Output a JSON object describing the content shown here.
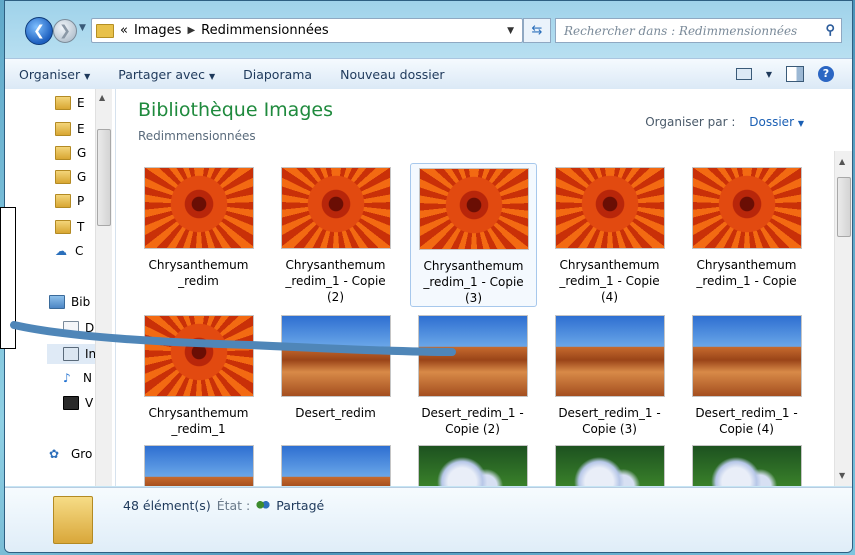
{
  "address": {
    "recent": "«",
    "crumbs": [
      "Images",
      "Redimmensionnées"
    ],
    "search_placeholder": "Rechercher dans : Redimmensionnées"
  },
  "toolbar": {
    "organize": "Organiser",
    "share": "Partager avec",
    "slideshow": "Diaporama",
    "new_folder": "Nouveau dossier"
  },
  "nav": {
    "items": [
      {
        "label": "E",
        "icon": "folder-icon"
      },
      {
        "label": "E",
        "icon": "folder-icon"
      },
      {
        "label": "G",
        "icon": "folder-icon"
      },
      {
        "label": "G",
        "icon": "folder-icon"
      },
      {
        "label": "P",
        "icon": "folder-icon"
      },
      {
        "label": "T",
        "icon": "download-folder-icon"
      },
      {
        "label": "C",
        "icon": "cloud-icon"
      },
      {
        "label": "Bib",
        "icon": "library-icon"
      },
      {
        "label": "D",
        "icon": "documents-icon"
      },
      {
        "label": "In",
        "icon": "images-icon"
      },
      {
        "label": "N",
        "icon": "music-icon"
      },
      {
        "label": "V",
        "icon": "video-icon"
      },
      {
        "label": "Gro",
        "icon": "homegroup-icon"
      }
    ]
  },
  "library": {
    "title": "Bibliothèque Images",
    "subtitle": "Redimmensionnées",
    "arrange_label": "Organiser par :",
    "arrange_value": "Dossier"
  },
  "files": [
    {
      "name": "Chrysanthemum _redim",
      "kind": "flower"
    },
    {
      "name": "Chrysanthemum _redim_1 - Copie (2)",
      "kind": "flower"
    },
    {
      "name": "Chrysanthemum _redim_1 - Copie (3)",
      "kind": "flower",
      "selected": true
    },
    {
      "name": "Chrysanthemum _redim_1 - Copie (4)",
      "kind": "flower"
    },
    {
      "name": "Chrysanthemum _redim_1 - Copie",
      "kind": "flower"
    },
    {
      "name": "Chrysanthemum _redim_1",
      "kind": "flower"
    },
    {
      "name": "Desert_redim",
      "kind": "desert"
    },
    {
      "name": "Desert_redim_1 - Copie (2)",
      "kind": "desert"
    },
    {
      "name": "Desert_redim_1 - Copie (3)",
      "kind": "desert"
    },
    {
      "name": "Desert_redim_1 - Copie (4)",
      "kind": "desert"
    },
    {
      "name": "",
      "kind": "desert"
    },
    {
      "name": "",
      "kind": "desert"
    },
    {
      "name": "",
      "kind": "hydr"
    },
    {
      "name": "",
      "kind": "hydr"
    },
    {
      "name": "",
      "kind": "hydr"
    }
  ],
  "details": {
    "count": "48 élément(s)",
    "state_label": "État :",
    "state_value": "Partagé"
  }
}
